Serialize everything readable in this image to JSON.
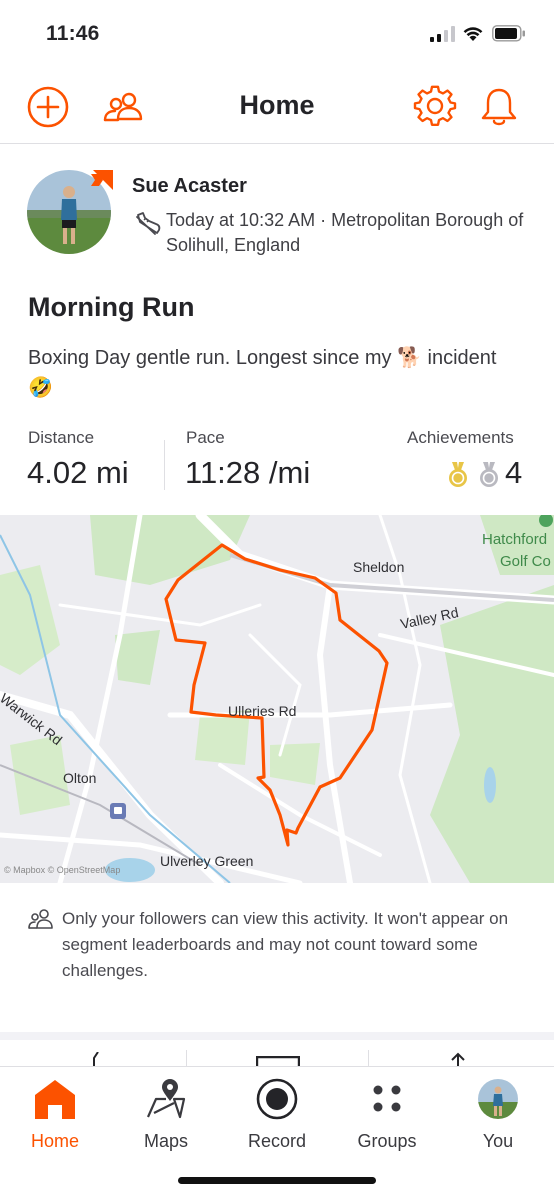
{
  "status_bar": {
    "time": "11:46"
  },
  "top_nav": {
    "title": "Home",
    "icons": [
      "add-circle-icon",
      "people-icon",
      "gear-icon",
      "bell-icon"
    ]
  },
  "colors": {
    "brand": "#fc5200",
    "gold": "#e8c547",
    "silver": "#b9b9c0"
  },
  "activity": {
    "athlete_name": "Sue Acaster",
    "meta": "Today at 10:32 AM · Metropolitan Borough of Solihull, England",
    "title": "Morning Run",
    "description": "Boxing Day gentle run. Longest since my 🐕 incident 🤣",
    "stats": {
      "distance_label": "Distance",
      "distance_value": "4.02 mi",
      "pace_label": "Pace",
      "pace_value": "11:28 /mi",
      "achievements_label": "Achievements",
      "achievements_count": "4"
    }
  },
  "map": {
    "labels": {
      "hatchford": "Hatchford",
      "golf": "Golf Co",
      "sheldon": "Sheldon",
      "valley_rd": "Valley Rd",
      "ulleries_rd": "Ulleries Rd",
      "warwick_rd": "Warwick Rd",
      "olton": "Olton",
      "ulverley_green": "Ulverley Green",
      "attribution": "© Mapbox © OpenStreetMap"
    }
  },
  "privacy_note": "Only your followers can view this activity. It won't appear on segment leaderboards and may not count toward some challenges.",
  "tab_bar": {
    "tabs": [
      {
        "label": "Home",
        "icon": "home-icon",
        "active": true
      },
      {
        "label": "Maps",
        "icon": "map-icon",
        "active": false
      },
      {
        "label": "Record",
        "icon": "record-icon",
        "active": false
      },
      {
        "label": "Groups",
        "icon": "groups-icon",
        "active": false
      },
      {
        "label": "You",
        "icon": "profile-avatar",
        "active": false
      }
    ]
  }
}
